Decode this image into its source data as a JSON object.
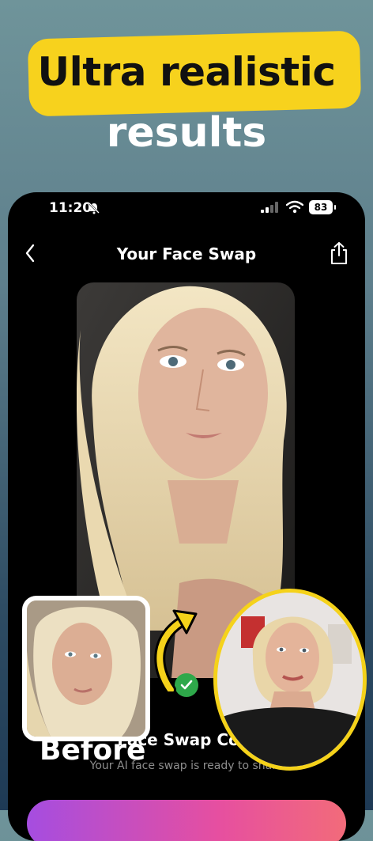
{
  "headline": {
    "line1": "Ultra realistic",
    "line2": "results"
  },
  "status_bar": {
    "time": "11:20",
    "battery": "83"
  },
  "nav": {
    "title": "Your Face Swap"
  },
  "completion": {
    "title": "Face Swap Com",
    "subtitle": "Your AI face swap is ready to share"
  },
  "overlay": {
    "before_label": "Before"
  },
  "colors": {
    "accent_yellow": "#f7d21d",
    "button_start": "#a54de0",
    "button_end": "#f26b7a"
  },
  "icons": [
    "bell-slash-icon",
    "signal-icon",
    "wifi-icon",
    "battery-icon",
    "back-chevron-icon",
    "share-icon",
    "checkmark-icon",
    "curved-arrow-icon"
  ]
}
